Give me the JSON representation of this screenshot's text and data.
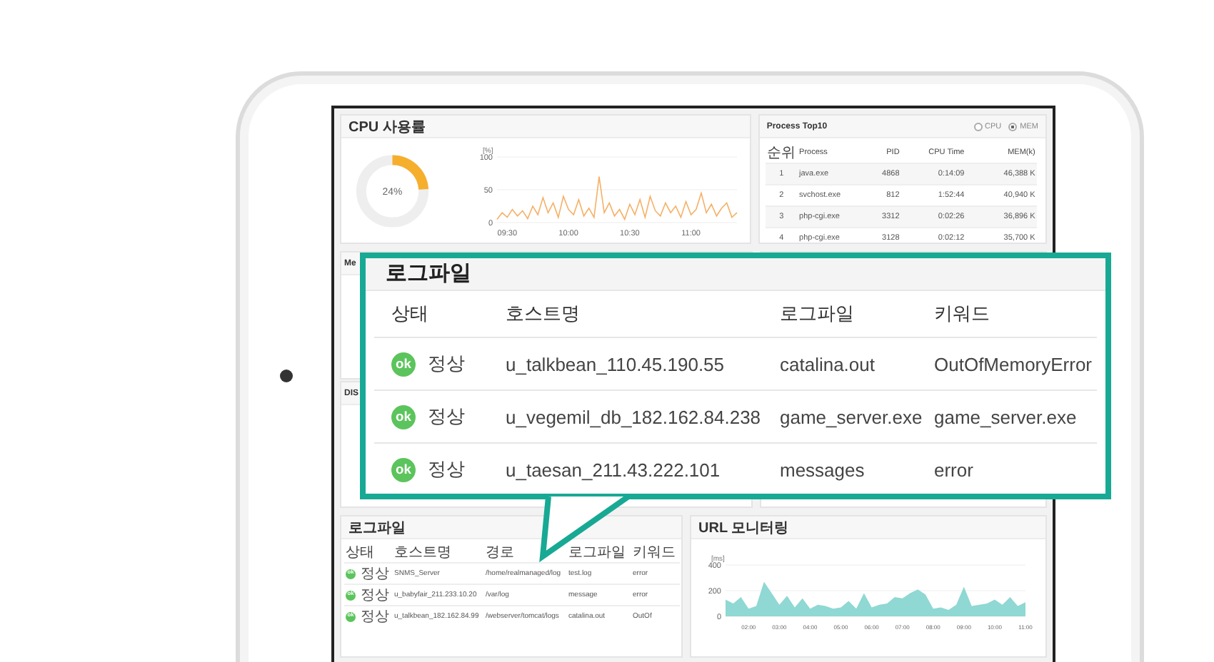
{
  "cpu_panel": {
    "title": "CPU 사용률",
    "gauge": {
      "level": 0.24,
      "label": "24%"
    },
    "chart_data": {
      "type": "line",
      "ylabel": "[%]",
      "ylim": [
        0,
        100
      ],
      "yticks": [
        0,
        50,
        100
      ],
      "categories": [
        null,
        null,
        "09:30",
        null,
        null,
        null,
        null,
        null,
        null,
        null,
        null,
        null,
        null,
        null,
        "10:00",
        null,
        null,
        null,
        null,
        null,
        null,
        null,
        null,
        null,
        null,
        null,
        "10:30",
        null,
        null,
        null,
        null,
        null,
        null,
        null,
        null,
        null,
        null,
        null,
        "11:00",
        null,
        null,
        null,
        null,
        null,
        null,
        null,
        null,
        null
      ],
      "series": [
        {
          "color": "#f5b066",
          "values": [
            5,
            15,
            8,
            20,
            10,
            18,
            6,
            25,
            12,
            38,
            15,
            30,
            8,
            40,
            20,
            12,
            35,
            10,
            22,
            8,
            70,
            15,
            30,
            10,
            20,
            5,
            28,
            12,
            35,
            8,
            40,
            18,
            10,
            30,
            15,
            25,
            8,
            32,
            12,
            20,
            45,
            15,
            28,
            10,
            22,
            30,
            8,
            15
          ]
        }
      ]
    }
  },
  "process_panel": {
    "title": "Process Top10",
    "options": [
      {
        "label": "CPU",
        "selected": false
      },
      {
        "label": "MEM",
        "selected": true
      }
    ],
    "columns": [
      "순위",
      "Process",
      "PID",
      "CPU Time",
      "MEM(k)"
    ],
    "rows": [
      [
        "1",
        "java.exe",
        "4868",
        "0:14:09",
        "46,388 K"
      ],
      [
        "2",
        "svchost.exe",
        "812",
        "1:52:44",
        "40,940 K"
      ],
      [
        "3",
        "php-cgi.exe",
        "3312",
        "0:02:26",
        "36,896 K"
      ],
      [
        "4",
        "php-cgi.exe",
        "3128",
        "0:02:12",
        "35,700 K"
      ]
    ]
  },
  "memory_panel": {
    "title": "Me"
  },
  "disk_panel": {
    "title": "DIS"
  },
  "log_panel": {
    "title": "로그파일",
    "columns": [
      "상태",
      "호스트명",
      "경로",
      "로그파일",
      "키워드"
    ],
    "rows": [
      {
        "status": {
          "icon": "ok",
          "label": "정상"
        },
        "host": "SNMS_Server",
        "path": "/home/realmanaged/log",
        "logfile": "test.log",
        "keyword": "error"
      },
      {
        "status": {
          "icon": "ok",
          "label": "정상"
        },
        "host": "u_babyfair_211.233.10.20",
        "path": "/var/log",
        "logfile": "message",
        "keyword": "error"
      },
      {
        "status": {
          "icon": "ok",
          "label": "정상"
        },
        "host": "u_talkbean_182.162.84.99",
        "path": "/webserver/tomcat/logs",
        "logfile": "catalina.out",
        "keyword": "OutOf"
      }
    ]
  },
  "url_panel": {
    "title": "URL 모니터링",
    "chart_data": {
      "type": "area",
      "ylabel": "[ms]",
      "ylim": [
        0,
        400
      ],
      "yticks": [
        0,
        200,
        400
      ],
      "categories": [
        null,
        null,
        null,
        "02:00",
        null,
        null,
        null,
        "03:00",
        null,
        null,
        null,
        "04:00",
        null,
        null,
        null,
        "05:00",
        null,
        null,
        null,
        "06:00",
        null,
        null,
        null,
        "07:00",
        null,
        null,
        null,
        "08:00",
        null,
        null,
        null,
        "09:00",
        null,
        null,
        null,
        "10:00",
        null,
        null,
        null,
        "11:00"
      ],
      "series": [
        {
          "color": "#8fd8d3",
          "values": [
            130,
            100,
            150,
            60,
            80,
            270,
            180,
            90,
            160,
            70,
            140,
            60,
            90,
            80,
            60,
            70,
            120,
            60,
            180,
            70,
            90,
            100,
            150,
            140,
            180,
            210,
            170,
            60,
            70,
            50,
            90,
            230,
            80,
            90,
            100,
            130,
            90,
            150,
            80,
            110
          ]
        }
      ]
    }
  },
  "callout": {
    "title": "로그파일",
    "columns": [
      "상태",
      "호스트명",
      "로그파일",
      "키워드"
    ],
    "rows": [
      {
        "status": {
          "icon": "ok",
          "label": "정상"
        },
        "host": "u_talkbean_110.45.190.55",
        "logfile": "catalina.out",
        "keyword": "OutOfMemoryError"
      },
      {
        "status": {
          "icon": "ok",
          "label": "정상"
        },
        "host": "u_vegemil_db_182.162.84.238",
        "logfile": "game_server.exe",
        "keyword": "game_server.exe"
      },
      {
        "status": {
          "icon": "ok",
          "label": "정상"
        },
        "host": "u_taesan_211.43.222.101",
        "logfile": "messages",
        "keyword": "error"
      }
    ]
  }
}
